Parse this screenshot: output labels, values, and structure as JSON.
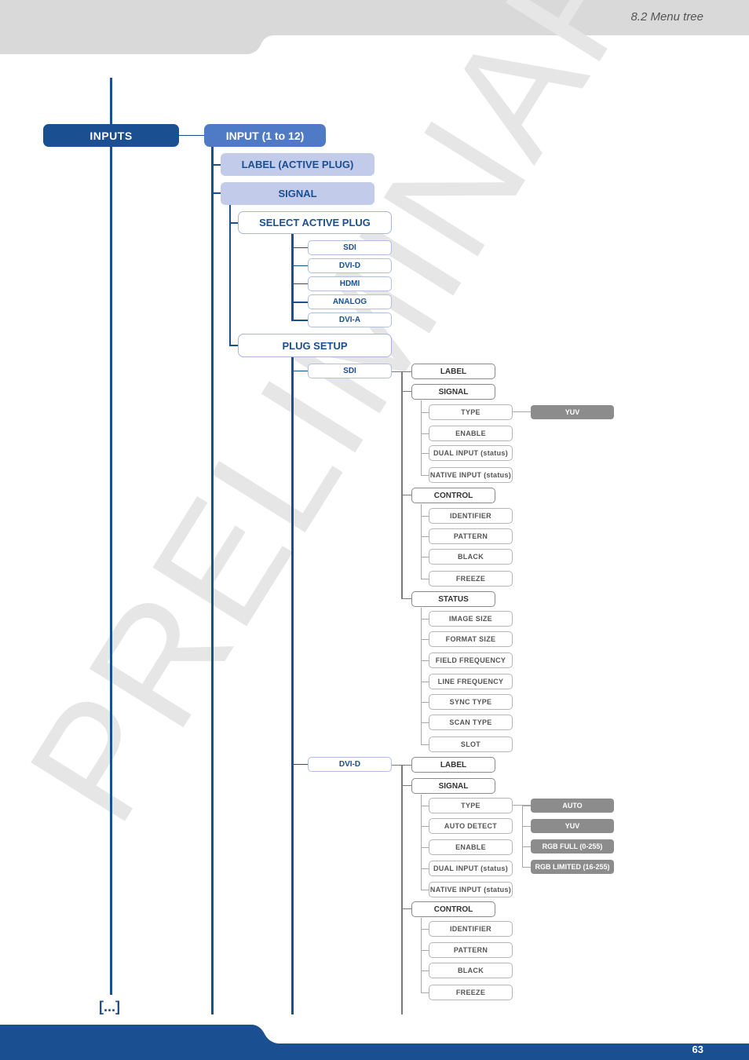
{
  "header": {
    "title": "8.2 Menu tree"
  },
  "footer": {
    "page_number": "63"
  },
  "watermark": {
    "text": "PRELIMINARY"
  },
  "colors": {
    "brand_blue": "#1a4f92",
    "header_gray": "#d9d9d9",
    "value_gray": "#8c8c8c"
  },
  "tree": {
    "root": "INPUTS",
    "level1": "INPUT (1 to 12)",
    "label_active_plug": "LABEL (ACTIVE PLUG)",
    "signal": "SIGNAL",
    "select_active_plug": "SELECT ACTIVE PLUG",
    "plugs": [
      "SDI",
      "DVI-D",
      "HDMI",
      "ANALOG",
      "DVI-A"
    ],
    "plug_setup": "PLUG SETUP",
    "sdi": {
      "name": "SDI",
      "label": "LABEL",
      "signal": "SIGNAL",
      "signal_items": [
        "TYPE",
        "ENABLE",
        "DUAL INPUT (status)",
        "NATIVE INPUT (status)"
      ],
      "type_values": [
        "YUV"
      ],
      "control": "CONTROL",
      "control_items": [
        "IDENTIFIER",
        "PATTERN",
        "BLACK",
        "FREEZE"
      ],
      "status": "STATUS",
      "status_items": [
        "IMAGE SIZE",
        "FORMAT SIZE",
        "FIELD FREQUENCY",
        "LINE FREQUENCY",
        "SYNC TYPE",
        "SCAN TYPE",
        "SLOT"
      ]
    },
    "dvid": {
      "name": "DVI-D",
      "label": "LABEL",
      "signal": "SIGNAL",
      "signal_items": [
        "TYPE",
        "AUTO DETECT",
        "ENABLE",
        "DUAL INPUT (status)",
        "NATIVE INPUT (status)"
      ],
      "type_values": [
        "AUTO",
        "YUV",
        "RGB FULL (0-255)",
        "RGB LIMITED (16-255)"
      ],
      "control": "CONTROL",
      "control_items": [
        "IDENTIFIER",
        "PATTERN",
        "BLACK",
        "FREEZE"
      ]
    },
    "continuation": "[...]"
  }
}
